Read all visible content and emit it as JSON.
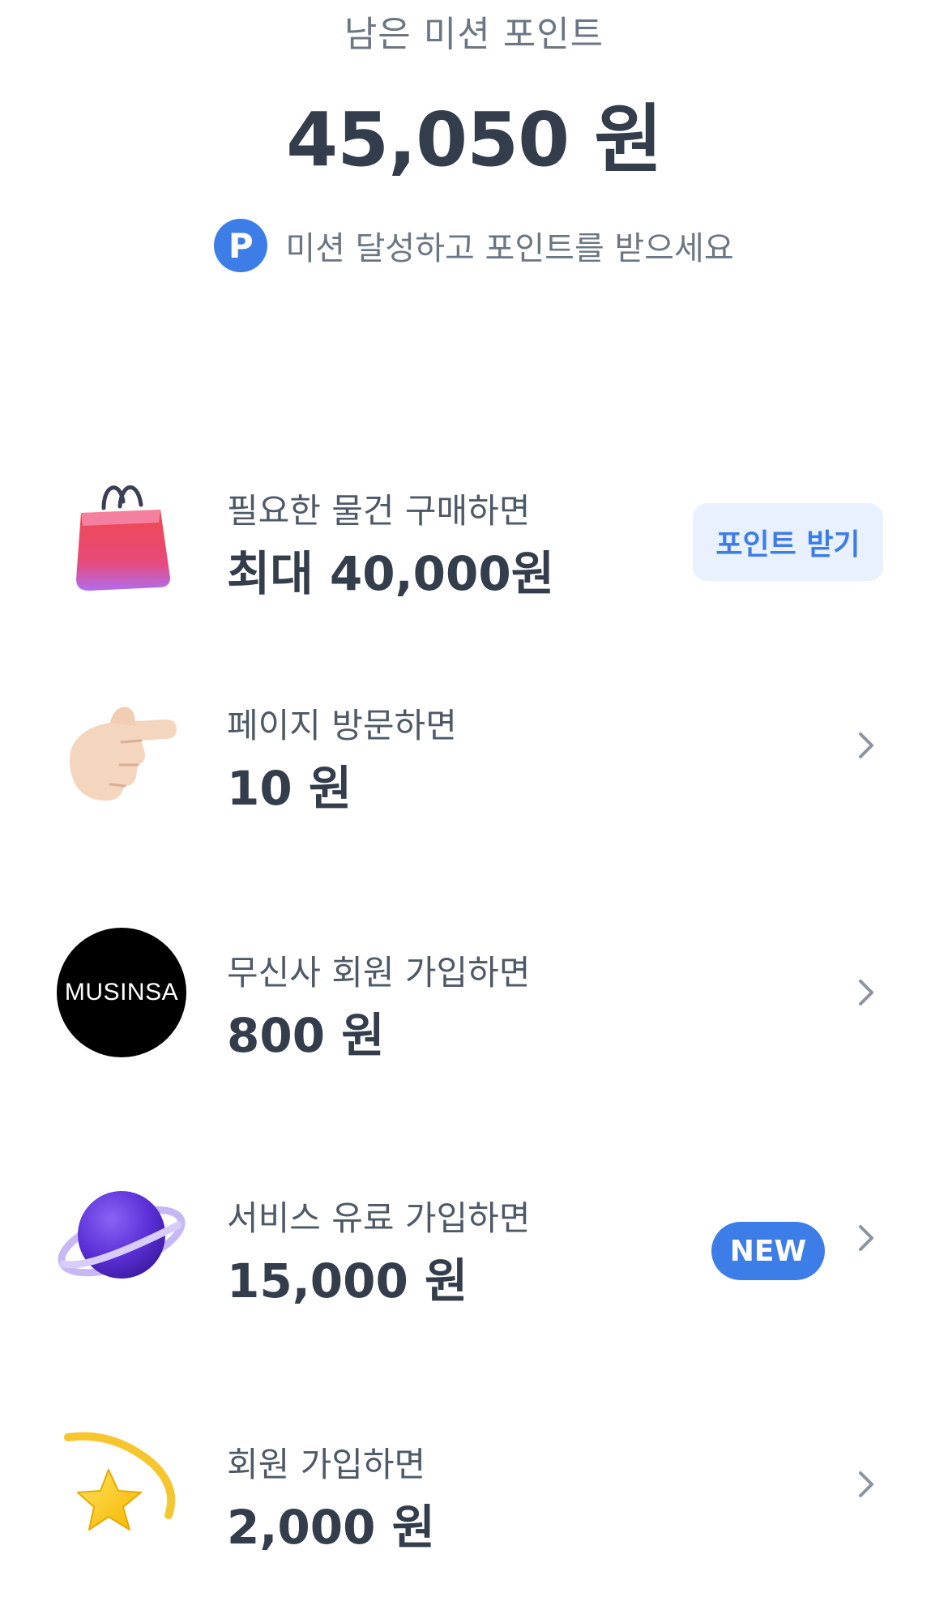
{
  "header": {
    "label": "남은 미션 포인트",
    "amount": "45,050 원",
    "hint_badge": "P",
    "hint_text": "미션 달성하고 포인트를 받으세요"
  },
  "missions": [
    {
      "icon": "shopping-bag-icon",
      "title": "필요한 물건 구매하면",
      "value": "최대 40,000원",
      "action_label": "포인트 받기"
    },
    {
      "icon": "pointing-hand-icon",
      "title": "페이지 방문하면",
      "value": "10 원"
    },
    {
      "icon": "musinsa-logo",
      "logo_text": "MUSINSA",
      "title": "무신사 회원 가입하면",
      "value": "800 원"
    },
    {
      "icon": "planet-icon",
      "title": "서비스 유료 가입하면",
      "value": "15,000 원",
      "badge": "NEW"
    },
    {
      "icon": "star-icon",
      "title": "회원 가입하면",
      "value": "2,000 원"
    }
  ],
  "colors": {
    "accent": "#3d7de8",
    "accent_soft": "#e8f1fd",
    "text_primary": "#333d4b",
    "text_secondary": "#6b7684"
  }
}
